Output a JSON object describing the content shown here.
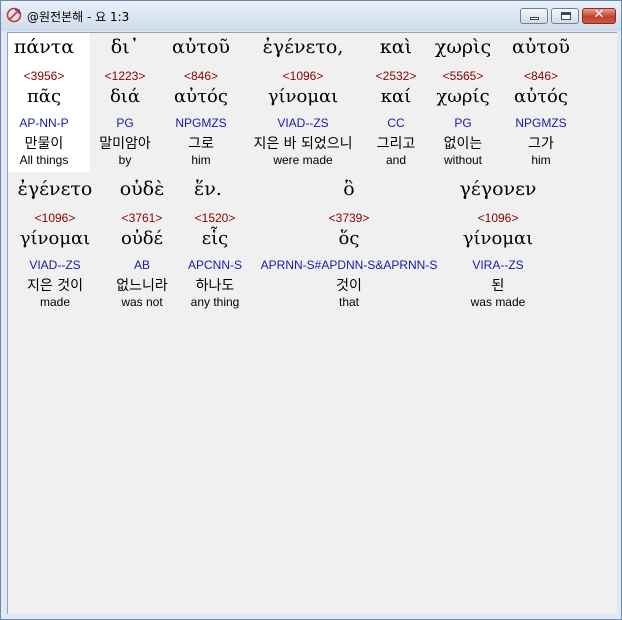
{
  "window": {
    "title": "@원전본해 - 요 1:3",
    "buttons": {
      "minimize": "minimize",
      "maximize": "maximize",
      "close": "✕"
    }
  },
  "colors": {
    "strong": "#8b0000",
    "parse": "#1a1aa8",
    "highlight": "#ffffff"
  },
  "words": [
    {
      "greek": "πάντα",
      "strong": "<3956>",
      "lemma": "πᾶς",
      "parse": "AP-NN-P",
      "korean": "만물이",
      "english": "All things"
    },
    {
      "greek": "δι᾽",
      "strong": "<1223>",
      "lemma": "διά",
      "parse": "PG",
      "korean": "말미암아",
      "english": "by"
    },
    {
      "greek": "αὐτοῦ",
      "strong": "<846>",
      "lemma": "αὐτός",
      "parse": "NPGMZS",
      "korean": "그로",
      "english": "him"
    },
    {
      "greek": "ἐγένετο,",
      "strong": "<1096>",
      "lemma": "γίνομαι",
      "parse": "VIAD--ZS",
      "korean": "지은 바 되었으니",
      "english": "were made"
    },
    {
      "greek": "καὶ",
      "strong": "<2532>",
      "lemma": "καί",
      "parse": "CC",
      "korean": "그리고",
      "english": "and"
    },
    {
      "greek": "χωρὶς",
      "strong": "<5565>",
      "lemma": "χωρίς",
      "parse": "PG",
      "korean": "없이는",
      "english": "without"
    },
    {
      "greek": "αὐτοῦ",
      "strong": "<846>",
      "lemma": "αὐτός",
      "parse": "NPGMZS",
      "korean": "그가",
      "english": "him"
    },
    {
      "greek": "ἐγένετο",
      "strong": "<1096>",
      "lemma": "γίνομαι",
      "parse": "VIAD--ZS",
      "korean": "지은 것이",
      "english": "made"
    },
    {
      "greek": "οὐδὲ",
      "strong": "<3761>",
      "lemma": "οὐδέ",
      "parse": "AB",
      "korean": "없느니라",
      "english": "was not"
    },
    {
      "greek": "ἕν.",
      "strong": "<1520>",
      "lemma": "εἷς",
      "parse": "APCNN-S",
      "korean": "하나도",
      "english": "any thing"
    },
    {
      "greek": "ὃ",
      "strong": "<3739>",
      "lemma": "ὅς",
      "parse": "APRNN-S#APDNN-S&APRNN-S",
      "korean": "것이",
      "english": "that"
    },
    {
      "greek": "γέγονεν",
      "strong": "<1096>",
      "lemma": "γίνομαι",
      "parse": "VIRA--ZS",
      "korean": "된",
      "english": "was made"
    }
  ]
}
